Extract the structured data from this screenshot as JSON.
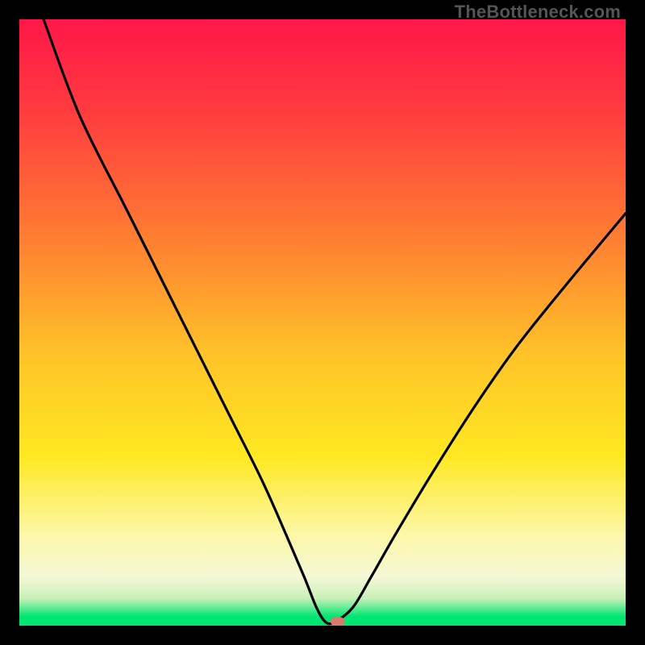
{
  "watermark": "TheBottleneck.com",
  "chart_data": {
    "type": "line",
    "title": "",
    "xlabel": "",
    "ylabel": "",
    "xlim": [
      0,
      100
    ],
    "ylim": [
      0,
      100
    ],
    "series": [
      {
        "name": "curve",
        "x": [
          4,
          10,
          18,
          26,
          34,
          40,
          44,
          47,
          49,
          50.5,
          52,
          55,
          58,
          62,
          68,
          75,
          82,
          90,
          100
        ],
        "y": [
          100,
          84,
          68,
          52,
          36,
          24,
          15,
          8,
          3,
          0.6,
          0.6,
          3,
          8,
          15,
          25,
          36,
          46,
          56,
          68
        ]
      }
    ],
    "marker": {
      "x": 52.5,
      "y": 0.7,
      "color": "#d97a6a"
    },
    "gradient_stops": [
      {
        "offset": 0.0,
        "color": "#ff1748"
      },
      {
        "offset": 0.15,
        "color": "#ff3b3f"
      },
      {
        "offset": 0.35,
        "color": "#ff7a33"
      },
      {
        "offset": 0.55,
        "color": "#ffc229"
      },
      {
        "offset": 0.72,
        "color": "#ffe821"
      },
      {
        "offset": 0.85,
        "color": "#fdf7a8"
      },
      {
        "offset": 0.92,
        "color": "#f4f8d6"
      },
      {
        "offset": 0.955,
        "color": "#c9f0b8"
      },
      {
        "offset": 0.985,
        "color": "#00e673"
      },
      {
        "offset": 1.0,
        "color": "#00e673"
      }
    ]
  }
}
